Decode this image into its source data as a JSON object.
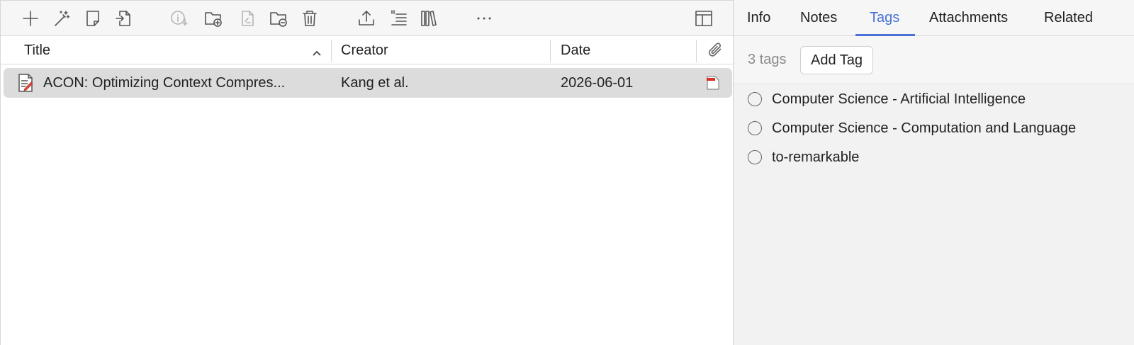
{
  "toolbar": {
    "buttons": [
      {
        "name": "new-item",
        "icon": "plus-icon",
        "enabled": true
      },
      {
        "name": "add-by-identifier",
        "icon": "magic-wand-icon",
        "enabled": true
      },
      {
        "name": "new-note",
        "icon": "note-icon",
        "enabled": true
      },
      {
        "name": "add-attachment",
        "icon": "import-file-icon",
        "enabled": true
      },
      {
        "name": "retrieve-metadata",
        "icon": "info-download-icon",
        "enabled": false
      },
      {
        "name": "new-collection",
        "icon": "folder-add-icon",
        "enabled": true
      },
      {
        "name": "create-parent",
        "icon": "document-gear-icon",
        "enabled": false
      },
      {
        "name": "remove-from-collection",
        "icon": "folder-remove-icon",
        "enabled": true
      },
      {
        "name": "move-to-trash",
        "icon": "trash-icon",
        "enabled": true
      },
      {
        "name": "export",
        "icon": "share-upload-icon",
        "enabled": true
      },
      {
        "name": "create-citation",
        "icon": "quote-lines-icon",
        "enabled": true
      },
      {
        "name": "library-lookup",
        "icon": "books-icon",
        "enabled": true
      },
      {
        "name": "more",
        "icon": "ellipsis-icon",
        "enabled": true
      },
      {
        "name": "toggle-layout",
        "icon": "layout-columns-icon",
        "enabled": true
      }
    ]
  },
  "columns": {
    "title": "Title",
    "creator": "Creator",
    "date": "Date",
    "sort_icon": "chevron-up-icon",
    "attachments_icon": "paperclip-icon"
  },
  "items": [
    {
      "title": "ACON: Optimizing Context Compres...",
      "creator": "Kang et al.",
      "date": "2026-06-01",
      "type_icon": "preprint-icon",
      "attachment_icon": "pdf-icon",
      "selected": true
    }
  ],
  "pane": {
    "tabs": [
      "Info",
      "Notes",
      "Tags",
      "Attachments",
      "Related"
    ],
    "active_tab": "Tags",
    "tag_count": "3 tags",
    "add_tag_label": "Add Tag",
    "tags": [
      "Computer Science - Artificial Intelligence",
      "Computer Science - Computation and Language",
      "to-remarkable"
    ]
  },
  "colors": {
    "accent": "#4a72d4",
    "selected_row": "#dcdcdc",
    "pane_bg": "#f2f2f2"
  }
}
